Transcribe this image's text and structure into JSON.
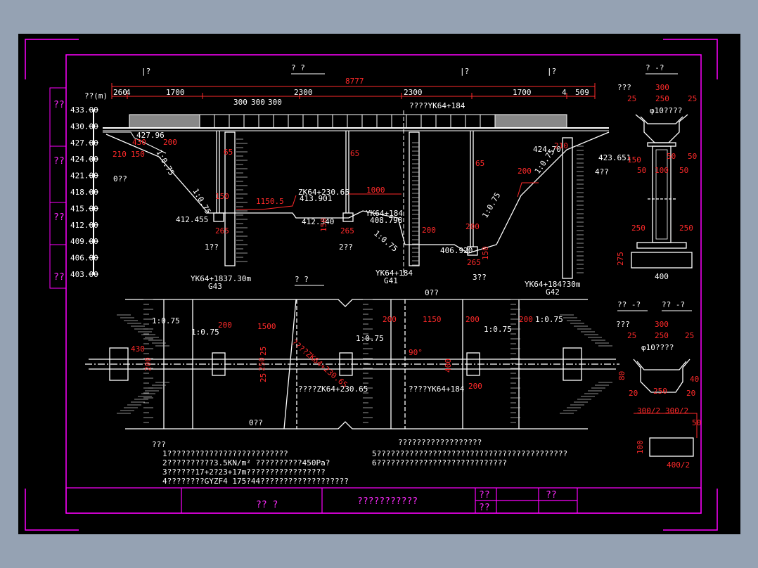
{
  "colors": {
    "background": "#95a2b3",
    "sheet": "#000000",
    "frame": "#ff00ff",
    "line": "#ffffff",
    "dimension": "#ff2a2a",
    "hatch": "#b7b7b7"
  },
  "elevation": {
    "title": "?  ?",
    "marks": [
      "|?",
      "|?",
      "|?",
      "|?"
    ],
    "total_dim": "8777",
    "top_dims": [
      "260",
      "4",
      "1700",
      "2300",
      "2300",
      "1700",
      "4",
      "509"
    ],
    "sub_dims": [
      "300",
      "300",
      "300"
    ],
    "scale_unit": "??(m)",
    "scale_values": [
      "433.00",
      "430.00",
      "427.00",
      "424.00",
      "421.00",
      "418.00",
      "415.00",
      "412.00",
      "409.00",
      "406.00",
      "403.00"
    ],
    "center_label": "????YK64+184",
    "pier_labels": [
      "1??",
      "2??",
      "3??"
    ],
    "abutment_labels": [
      "0??",
      "4??"
    ],
    "left_station": "YK64+1837.30m",
    "left_code": "G43",
    "mid_station": "YK64+184",
    "mid_code": "G41",
    "right_station": "YK64+184?30m",
    "right_code": "G42",
    "elev_labels": [
      "427.96",
      "412.455",
      "412.340",
      "408.798",
      "406.920",
      "424.70",
      "423.651",
      "413.901"
    ],
    "zk_label": "ZK64+230.65",
    "slopes": [
      "1:0.75",
      "1:0.75",
      "1:0.75",
      "1:0.75",
      "1:0.75"
    ],
    "red_dims": [
      "430",
      "210",
      "150",
      "200",
      "65",
      "65",
      "65",
      "200",
      "150",
      "1150.5",
      "1000",
      "265",
      "265",
      "265",
      "200",
      "200",
      "150",
      "150",
      "210"
    ]
  },
  "plan": {
    "title": "?  ?",
    "dims": [
      "1500",
      "200",
      "1150",
      "200",
      "200",
      "200",
      "430",
      "200",
      "250",
      "25",
      "25",
      "400",
      "200",
      "90°"
    ],
    "labels": [
      "????ZK64+230.65",
      "????YK64+184",
      "0??",
      "0??"
    ],
    "slopes": [
      "1:0.75",
      "1:0.75",
      "1:0.75",
      "1:0.75",
      "1:0.75"
    ]
  },
  "section_a": {
    "title": "? -?",
    "tag": "???",
    "dims": [
      "300",
      "250",
      "25",
      "25",
      "150",
      "50",
      "50",
      "100",
      "50",
      "50",
      "250",
      "250",
      "275",
      "400"
    ],
    "note": "φ10????"
  },
  "section_b": {
    "title1": "?? -?",
    "title2": "?? -?",
    "tag": "???",
    "dims": [
      "300",
      "250",
      "25",
      "25",
      "80",
      "40",
      "20",
      "250",
      "20",
      "300/2",
      "300/2",
      "50",
      "100",
      "400/2"
    ],
    "note": "φ10????"
  },
  "notes": {
    "heading": "???",
    "lines": [
      "1??????????????????????????",
      "2??????????3.5KN/m²   ??????????450Pa?",
      "3??????17+2?23+17m?????????????????",
      "4????????GYZF4  175?44???????????????????",
      "5?????????????????????????????????????????",
      "6????????????????????????????"
    ],
    "right_heading": "??????????????????"
  },
  "side_labels": [
    "??",
    "??",
    "??",
    "??"
  ],
  "title_block": {
    "designer": "??    ?",
    "drawing_name": "???????????",
    "cells": [
      "??",
      "??",
      "??"
    ]
  }
}
